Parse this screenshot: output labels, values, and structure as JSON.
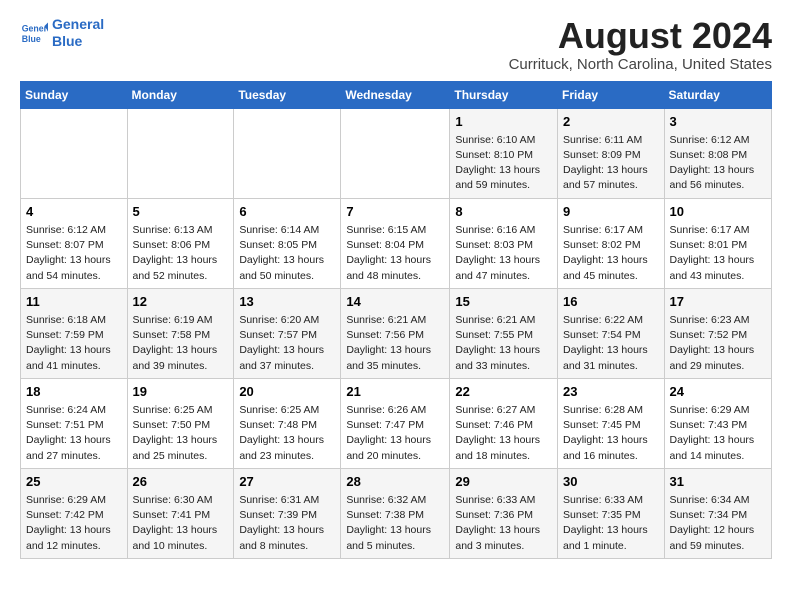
{
  "logo": {
    "line1": "General",
    "line2": "Blue"
  },
  "title": "August 2024",
  "subtitle": "Currituck, North Carolina, United States",
  "weekdays": [
    "Sunday",
    "Monday",
    "Tuesday",
    "Wednesday",
    "Thursday",
    "Friday",
    "Saturday"
  ],
  "weeks": [
    [
      {
        "day": "",
        "info": ""
      },
      {
        "day": "",
        "info": ""
      },
      {
        "day": "",
        "info": ""
      },
      {
        "day": "",
        "info": ""
      },
      {
        "day": "1",
        "info": "Sunrise: 6:10 AM\nSunset: 8:10 PM\nDaylight: 13 hours and 59 minutes."
      },
      {
        "day": "2",
        "info": "Sunrise: 6:11 AM\nSunset: 8:09 PM\nDaylight: 13 hours and 57 minutes."
      },
      {
        "day": "3",
        "info": "Sunrise: 6:12 AM\nSunset: 8:08 PM\nDaylight: 13 hours and 56 minutes."
      }
    ],
    [
      {
        "day": "4",
        "info": "Sunrise: 6:12 AM\nSunset: 8:07 PM\nDaylight: 13 hours and 54 minutes."
      },
      {
        "day": "5",
        "info": "Sunrise: 6:13 AM\nSunset: 8:06 PM\nDaylight: 13 hours and 52 minutes."
      },
      {
        "day": "6",
        "info": "Sunrise: 6:14 AM\nSunset: 8:05 PM\nDaylight: 13 hours and 50 minutes."
      },
      {
        "day": "7",
        "info": "Sunrise: 6:15 AM\nSunset: 8:04 PM\nDaylight: 13 hours and 48 minutes."
      },
      {
        "day": "8",
        "info": "Sunrise: 6:16 AM\nSunset: 8:03 PM\nDaylight: 13 hours and 47 minutes."
      },
      {
        "day": "9",
        "info": "Sunrise: 6:17 AM\nSunset: 8:02 PM\nDaylight: 13 hours and 45 minutes."
      },
      {
        "day": "10",
        "info": "Sunrise: 6:17 AM\nSunset: 8:01 PM\nDaylight: 13 hours and 43 minutes."
      }
    ],
    [
      {
        "day": "11",
        "info": "Sunrise: 6:18 AM\nSunset: 7:59 PM\nDaylight: 13 hours and 41 minutes."
      },
      {
        "day": "12",
        "info": "Sunrise: 6:19 AM\nSunset: 7:58 PM\nDaylight: 13 hours and 39 minutes."
      },
      {
        "day": "13",
        "info": "Sunrise: 6:20 AM\nSunset: 7:57 PM\nDaylight: 13 hours and 37 minutes."
      },
      {
        "day": "14",
        "info": "Sunrise: 6:21 AM\nSunset: 7:56 PM\nDaylight: 13 hours and 35 minutes."
      },
      {
        "day": "15",
        "info": "Sunrise: 6:21 AM\nSunset: 7:55 PM\nDaylight: 13 hours and 33 minutes."
      },
      {
        "day": "16",
        "info": "Sunrise: 6:22 AM\nSunset: 7:54 PM\nDaylight: 13 hours and 31 minutes."
      },
      {
        "day": "17",
        "info": "Sunrise: 6:23 AM\nSunset: 7:52 PM\nDaylight: 13 hours and 29 minutes."
      }
    ],
    [
      {
        "day": "18",
        "info": "Sunrise: 6:24 AM\nSunset: 7:51 PM\nDaylight: 13 hours and 27 minutes."
      },
      {
        "day": "19",
        "info": "Sunrise: 6:25 AM\nSunset: 7:50 PM\nDaylight: 13 hours and 25 minutes."
      },
      {
        "day": "20",
        "info": "Sunrise: 6:25 AM\nSunset: 7:48 PM\nDaylight: 13 hours and 23 minutes."
      },
      {
        "day": "21",
        "info": "Sunrise: 6:26 AM\nSunset: 7:47 PM\nDaylight: 13 hours and 20 minutes."
      },
      {
        "day": "22",
        "info": "Sunrise: 6:27 AM\nSunset: 7:46 PM\nDaylight: 13 hours and 18 minutes."
      },
      {
        "day": "23",
        "info": "Sunrise: 6:28 AM\nSunset: 7:45 PM\nDaylight: 13 hours and 16 minutes."
      },
      {
        "day": "24",
        "info": "Sunrise: 6:29 AM\nSunset: 7:43 PM\nDaylight: 13 hours and 14 minutes."
      }
    ],
    [
      {
        "day": "25",
        "info": "Sunrise: 6:29 AM\nSunset: 7:42 PM\nDaylight: 13 hours and 12 minutes."
      },
      {
        "day": "26",
        "info": "Sunrise: 6:30 AM\nSunset: 7:41 PM\nDaylight: 13 hours and 10 minutes."
      },
      {
        "day": "27",
        "info": "Sunrise: 6:31 AM\nSunset: 7:39 PM\nDaylight: 13 hours and 8 minutes."
      },
      {
        "day": "28",
        "info": "Sunrise: 6:32 AM\nSunset: 7:38 PM\nDaylight: 13 hours and 5 minutes."
      },
      {
        "day": "29",
        "info": "Sunrise: 6:33 AM\nSunset: 7:36 PM\nDaylight: 13 hours and 3 minutes."
      },
      {
        "day": "30",
        "info": "Sunrise: 6:33 AM\nSunset: 7:35 PM\nDaylight: 13 hours and 1 minute."
      },
      {
        "day": "31",
        "info": "Sunrise: 6:34 AM\nSunset: 7:34 PM\nDaylight: 12 hours and 59 minutes."
      }
    ]
  ]
}
